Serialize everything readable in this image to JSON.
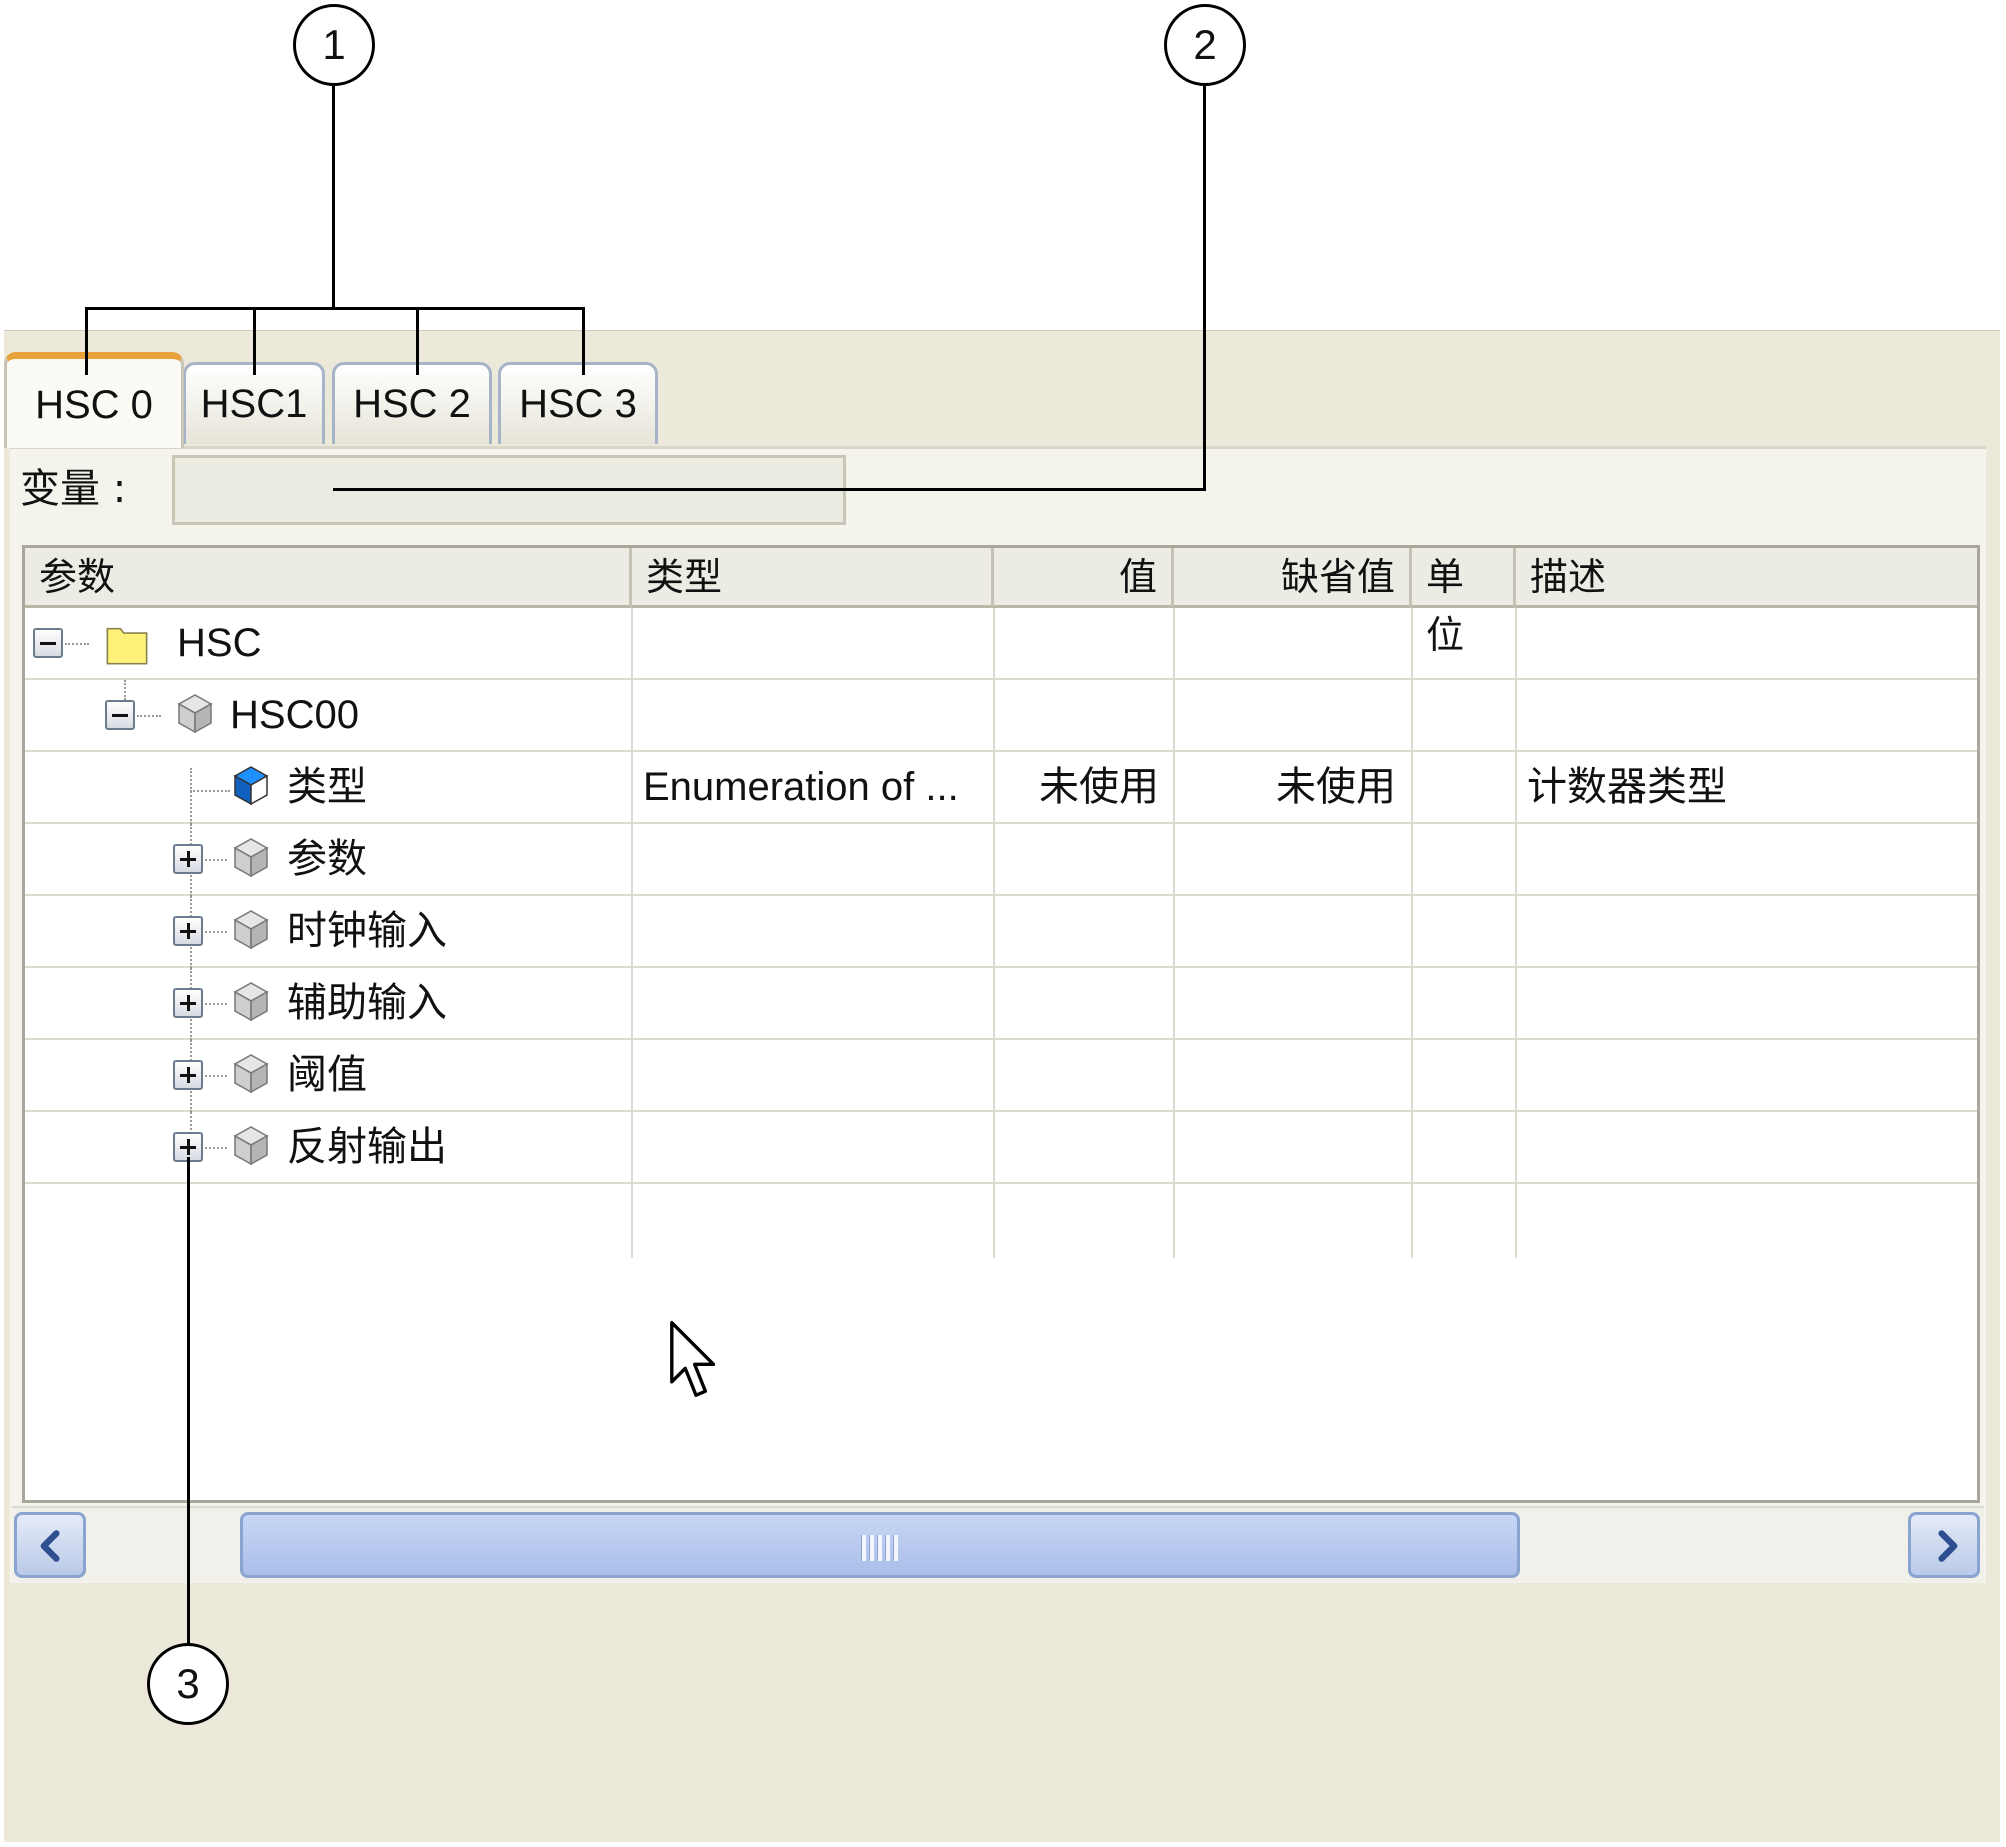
{
  "callouts": [
    "1",
    "2",
    "3"
  ],
  "tabs": [
    {
      "label": "HSC 0",
      "active": true
    },
    {
      "label": "HSC1",
      "active": false
    },
    {
      "label": "HSC 2",
      "active": false
    },
    {
      "label": "HSC 3",
      "active": false
    }
  ],
  "variable": {
    "label": "变量 :",
    "value": ""
  },
  "table": {
    "headers": {
      "param": "参数",
      "type": "类型",
      "value": "值",
      "default": "缺省值",
      "unit": "单位",
      "desc": "描述"
    },
    "rows": [
      {
        "name": "HSC",
        "type": "",
        "value": "",
        "default": "",
        "unit": "",
        "desc": "",
        "icon": "folder-icon",
        "toggle": "collapse"
      },
      {
        "name": "HSC00",
        "type": "",
        "value": "",
        "default": "",
        "unit": "",
        "desc": "",
        "icon": "cube-icon",
        "toggle": "collapse"
      },
      {
        "name": "类型",
        "type": "Enumeration of ...",
        "value": "未使用",
        "default": "未使用",
        "unit": "",
        "desc": "计数器类型",
        "icon": "blue-cube-icon",
        "toggle": "none"
      },
      {
        "name": "参数",
        "icon": "cube-icon",
        "toggle": "expand"
      },
      {
        "name": "时钟输入",
        "icon": "cube-icon",
        "toggle": "expand"
      },
      {
        "name": "辅助输入",
        "icon": "cube-icon",
        "toggle": "expand"
      },
      {
        "name": "阈值",
        "icon": "cube-icon",
        "toggle": "expand"
      },
      {
        "name": "反射输出",
        "icon": "cube-icon",
        "toggle": "expand"
      }
    ]
  },
  "colors": {
    "active_tab_accent": "#e9a23a",
    "scroll_blue": "#a9bee9",
    "folder_yellow": "#fff27a",
    "blue_cube": "#1e90ff"
  }
}
